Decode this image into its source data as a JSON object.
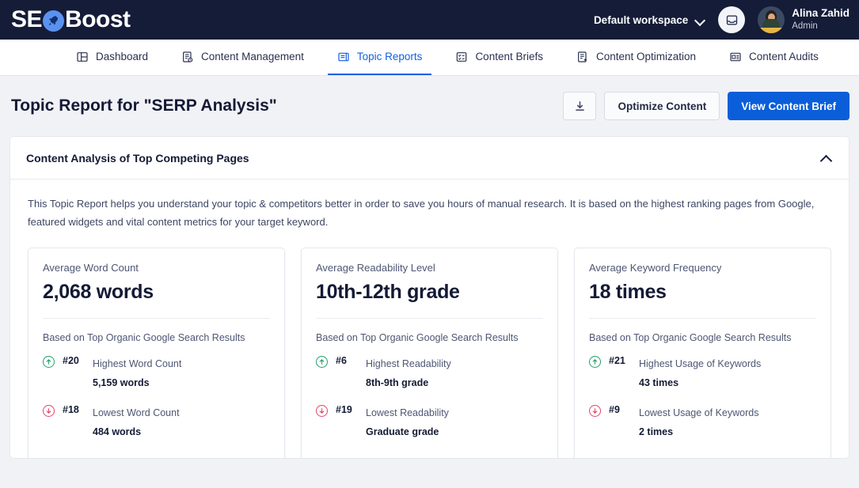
{
  "brand": {
    "name_part1": "SE",
    "name_part2": "Boost",
    "accent_color": "#5a92f0",
    "bar_color": "#151c38"
  },
  "topbar": {
    "workspace_label": "Default workspace",
    "inbox_icon": "inbox-icon",
    "user_name": "Alina Zahid",
    "user_role": "Admin"
  },
  "nav": {
    "items": [
      {
        "label": "Dashboard",
        "icon": "layout-dashboard-icon",
        "active": false
      },
      {
        "label": "Content Management",
        "icon": "document-clock-icon",
        "active": false
      },
      {
        "label": "Topic Reports",
        "icon": "folder-report-icon",
        "active": true
      },
      {
        "label": "Content Briefs",
        "icon": "checklist-icon",
        "active": false
      },
      {
        "label": "Content Optimization",
        "icon": "document-plus-icon",
        "active": false
      },
      {
        "label": "Content Audits",
        "icon": "audit-list-icon",
        "active": false
      }
    ],
    "active_color": "#1161e0"
  },
  "page": {
    "title": "Topic Report for \"SERP Analysis\"",
    "download_icon": "download-icon",
    "optimize_button": "Optimize Content",
    "view_brief_button": "View Content Brief",
    "primary_color": "#0a5ed9"
  },
  "panel": {
    "title": "Content Analysis of Top Competing Pages",
    "collapse_icon": "chevron-up-icon",
    "description": "This Topic Report helps you understand your topic & competitors better in order to save you hours of manual research. It is based on the highest ranking pages from Google, featured widgets and vital content metrics for your target keyword."
  },
  "cards": [
    {
      "label": "Average Word Count",
      "value": "2,068 words",
      "sub": "Based on Top Organic Google Search Results",
      "stats": [
        {
          "direction": "up",
          "rank": "#20",
          "name": "Highest Word Count",
          "value": "5,159 words"
        },
        {
          "direction": "down",
          "rank": "#18",
          "name": "Lowest Word Count",
          "value": "484 words"
        }
      ]
    },
    {
      "label": "Average Readability Level",
      "value": "10th-12th grade",
      "sub": "Based on Top Organic Google Search Results",
      "stats": [
        {
          "direction": "up",
          "rank": "#6",
          "name": "Highest Readability",
          "value": "8th-9th grade"
        },
        {
          "direction": "down",
          "rank": "#19",
          "name": "Lowest Readability",
          "value": "Graduate grade"
        }
      ]
    },
    {
      "label": "Average Keyword Frequency",
      "value": "18 times",
      "sub": "Based on Top Organic Google Search Results",
      "stats": [
        {
          "direction": "up",
          "rank": "#21",
          "name": "Highest Usage of Keywords",
          "value": "43 times"
        },
        {
          "direction": "down",
          "rank": "#9",
          "name": "Lowest Usage of Keywords",
          "value": "2 times"
        }
      ]
    }
  ],
  "colors": {
    "up": "#22a06b",
    "down": "#e1456b",
    "background": "#f1f2f6"
  }
}
